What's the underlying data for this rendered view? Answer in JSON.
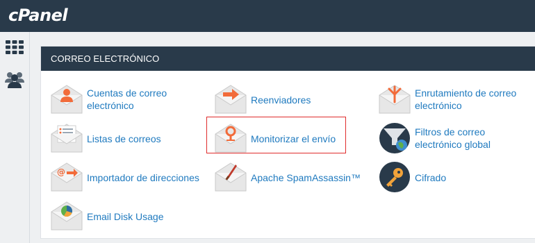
{
  "app": {
    "logo": "cPanel"
  },
  "sidebar": {
    "items": [
      {
        "icon": "grid-icon"
      },
      {
        "icon": "users-icon"
      }
    ]
  },
  "panel": {
    "title": "CORREO ELECTRÓNICO",
    "items": [
      {
        "label": "Cuentas de correo electrónico",
        "icon": "email-accounts-icon"
      },
      {
        "label": "Reenviadores",
        "icon": "forwarders-icon"
      },
      {
        "label": "Enrutamiento de correo electrónico",
        "icon": "email-routing-icon"
      },
      {
        "label": "Listas de correos",
        "icon": "mailing-lists-icon"
      },
      {
        "label": "Monitorizar el envío",
        "icon": "track-delivery-icon",
        "highlighted": true
      },
      {
        "label": "Filtros de correo electrónico global",
        "icon": "global-filters-icon"
      },
      {
        "label": "Importador de direcciones",
        "icon": "address-importer-icon"
      },
      {
        "label": "Apache SpamAssassin™",
        "icon": "spamassassin-icon"
      },
      {
        "label": "Cifrado",
        "icon": "encryption-icon"
      },
      {
        "label": "Email Disk Usage",
        "icon": "email-disk-usage-icon"
      }
    ]
  },
  "colors": {
    "header": "#293a4a",
    "link": "#1f7abf",
    "highlight": "#e02b2b",
    "accent": "#f26b3a"
  }
}
